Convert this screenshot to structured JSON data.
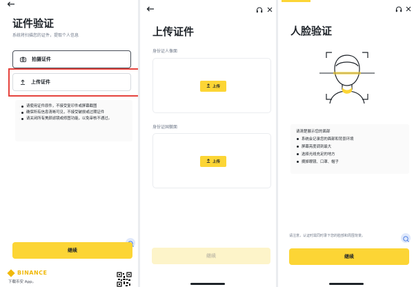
{
  "screen1": {
    "back_icon": "back-arrow-icon",
    "title": "证件验证",
    "subtitle": "系统将扫描您的证件，提取个人信息",
    "options": [
      {
        "label": "拍摄证件",
        "icon": "camera-icon"
      },
      {
        "label": "上传证件",
        "icon": "upload-icon"
      }
    ],
    "tips": [
      "请使用证件原件，不接受复印件或屏幕截图",
      "确保所有信息清晰可见，不接受破损或过期证件",
      "请关闭所有美颜滤镜或修图功能，以免审核不通过。"
    ],
    "continue_label": "继续",
    "brand": "BINANCE",
    "download_text": "下载币安 App。"
  },
  "screen2": {
    "title": "上传证件",
    "front_label": "身份证人像面",
    "back_label": "身份证国徽面",
    "upload_label": "上传",
    "continue_label": "继续"
  },
  "screen3": {
    "title": "人脸验证",
    "req_heading": "请清楚展示您的面部",
    "requirements": [
      "系统会记录您的面部和背景环境",
      "屏幕亮度调到最大",
      "选择光线充足的地方",
      "摘掉眼镜、口罩、帽子"
    ],
    "note": "请注意，认证时需同时录下您的脸部和周围背景。",
    "continue_label": "继续"
  },
  "colors": {
    "accent": "#fcd535",
    "highlight": "#e5423c",
    "text": "#1e2329",
    "muted": "#707a8a"
  }
}
